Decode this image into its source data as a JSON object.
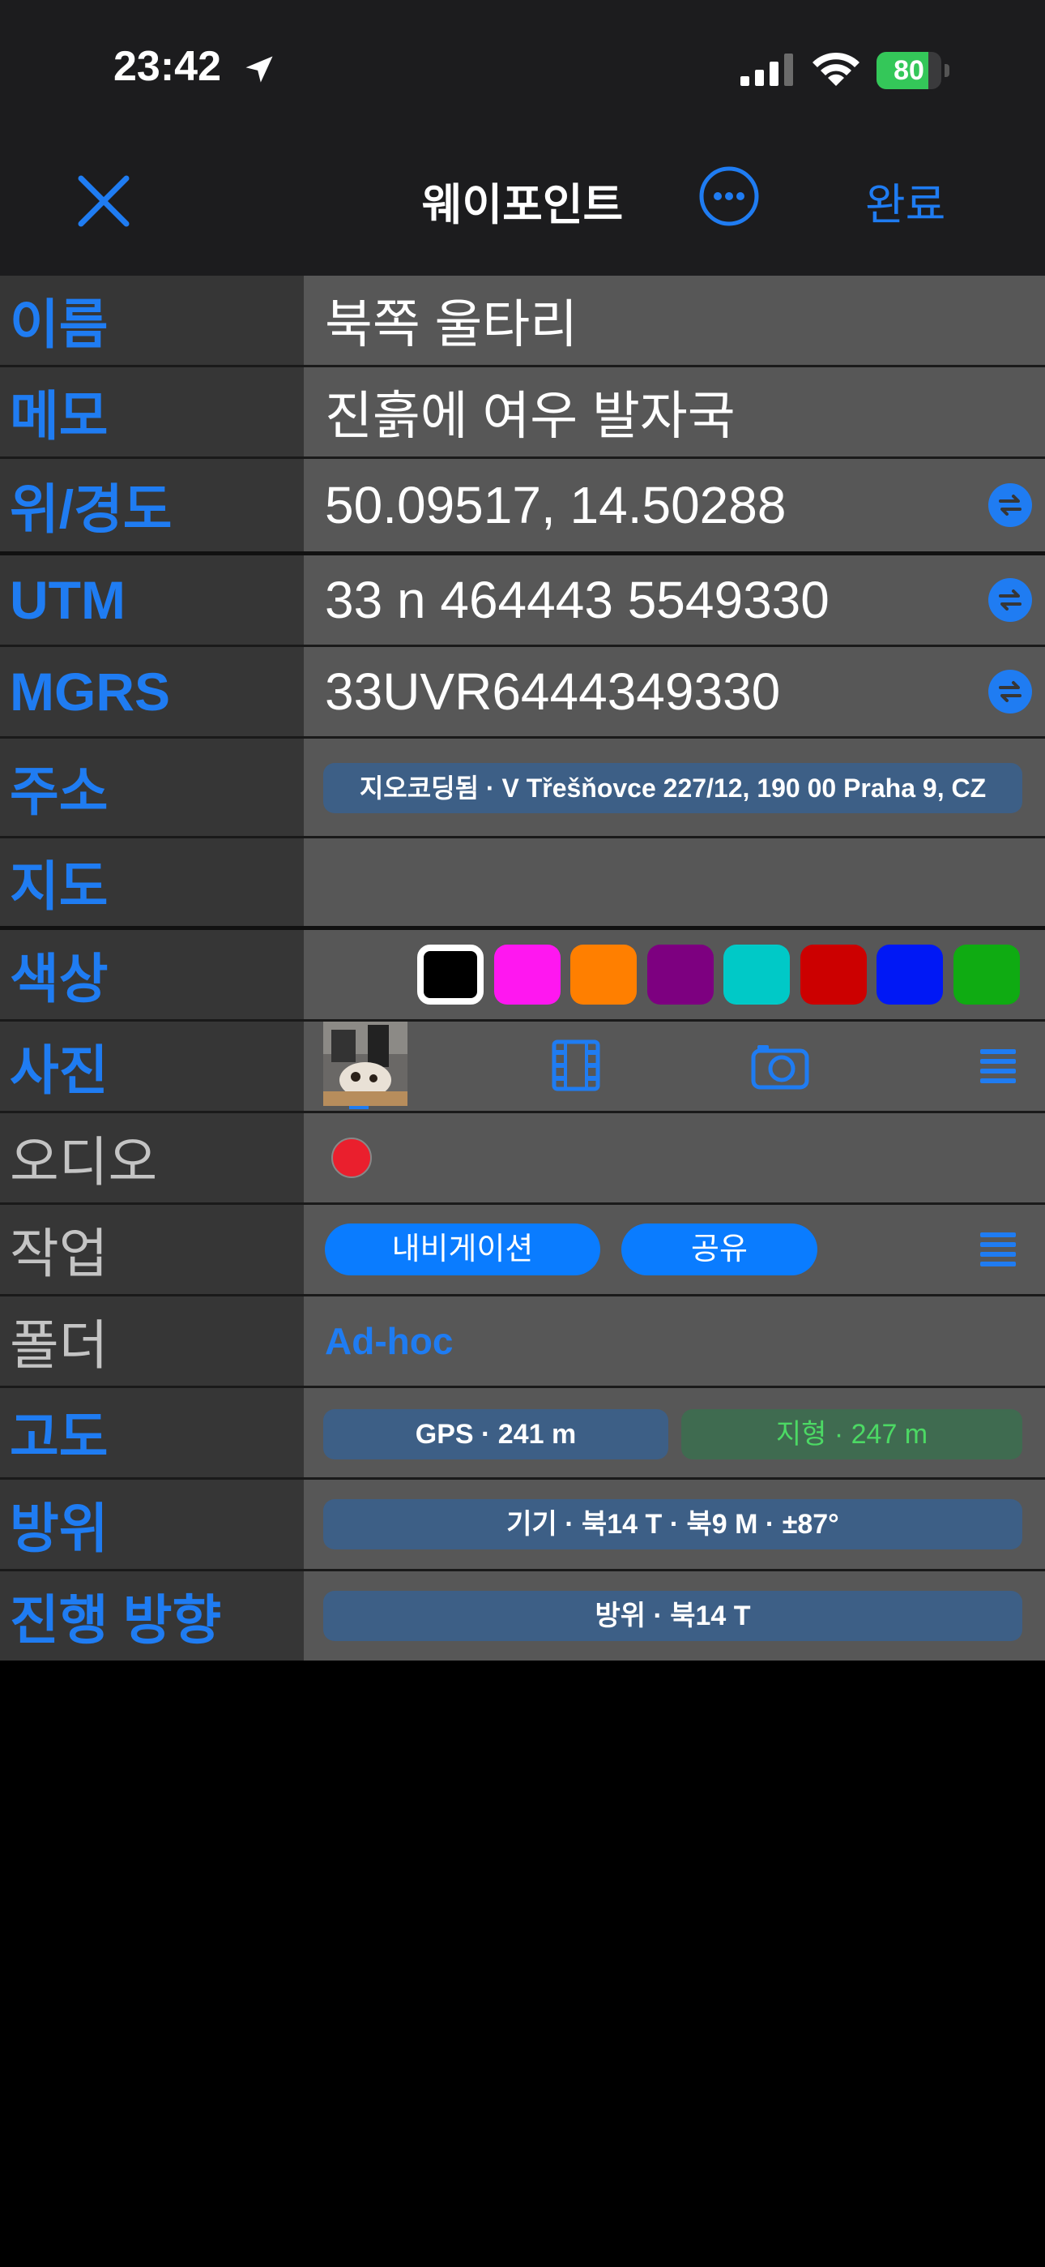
{
  "status_bar": {
    "time": "23:42",
    "battery_level": 80,
    "battery_text": "80"
  },
  "nav": {
    "title": "웨이포인트",
    "done": "완료"
  },
  "rows": {
    "name": {
      "label": "이름",
      "value": "북쪽 울타리"
    },
    "memo": {
      "label": "메모",
      "value": "진흙에 여우 발자국"
    },
    "latlon": {
      "label": "위/경도",
      "value": "50.09517, 14.50288"
    },
    "utm": {
      "label": "UTM",
      "value": "33 n 464443 5549330"
    },
    "mgrs": {
      "label": "MGRS",
      "value": "33UVR6444349330"
    },
    "address": {
      "label": "주소",
      "value": "지오코딩됨 · V Třešňovce 227/12, 190 00 Praha 9, CZ"
    },
    "map": {
      "label": "지도"
    },
    "color": {
      "label": "색상",
      "swatches": [
        "#000000",
        "#ff17f0",
        "#ff7f00",
        "#7d0080",
        "#00c9c7",
        "#cc0000",
        "#0018f5",
        "#0fab12"
      ],
      "selected_index": 0
    },
    "photo": {
      "label": "사진"
    },
    "audio": {
      "label": "오디오"
    },
    "actions": {
      "label": "작업",
      "navigate": "내비게이션",
      "share": "공유"
    },
    "folder": {
      "label": "폴더",
      "value": "Ad-hoc"
    },
    "altitude": {
      "label": "고도",
      "gps": "GPS · 241 m",
      "terrain": "지형 · 247 m"
    },
    "bearing": {
      "label": "방위",
      "value": "기기 · 북14 T · 북9 M · ±87°"
    },
    "heading": {
      "label": "진행 방향",
      "value": "방위 · 북14 T"
    }
  }
}
